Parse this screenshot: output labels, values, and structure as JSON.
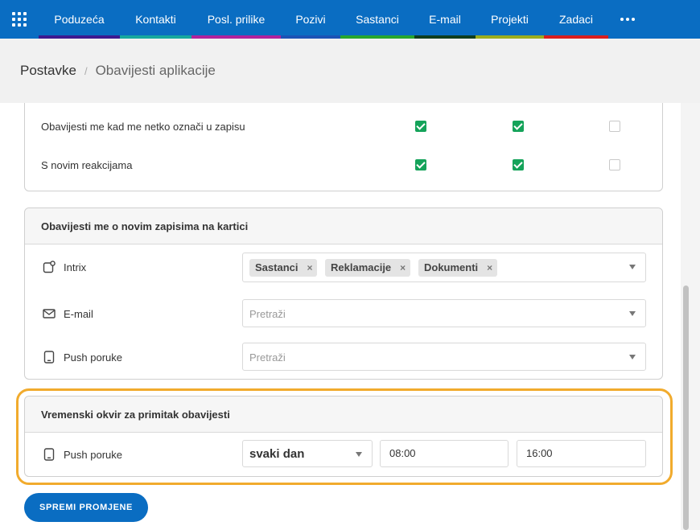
{
  "nav": {
    "items": [
      {
        "label": "Poduzeća",
        "color": "#3d1a8f"
      },
      {
        "label": "Kontakti",
        "color": "#16a89e"
      },
      {
        "label": "Posl. prilike",
        "color": "#b0239c"
      },
      {
        "label": "Pozivi",
        "color": "#1c53b5"
      },
      {
        "label": "Sastanci",
        "color": "#27a52e"
      },
      {
        "label": "E-mail",
        "color": "#0f3d1e"
      },
      {
        "label": "Projekti",
        "color": "#9aac1e"
      },
      {
        "label": "Zadaci",
        "color": "#d81e1e"
      }
    ]
  },
  "breadcrumb": {
    "root": "Postavke",
    "separator": "/",
    "current": "Obavijesti aplikacije"
  },
  "notify_rows": [
    {
      "label": "Obavijesti me kad me netko označi u zapisu",
      "checks": [
        true,
        true,
        false
      ]
    },
    {
      "label": "S novim reakcijama",
      "checks": [
        true,
        true,
        false
      ]
    }
  ],
  "records_section": {
    "title": "Obavijesti me o novim zapisima na kartici",
    "channels": [
      {
        "icon": "intrix-icon",
        "label": "Intrix",
        "tags": [
          "Sastanci",
          "Reklamacije",
          "Dokumenti"
        ],
        "tag_remove": "×"
      },
      {
        "icon": "mail-icon",
        "label": "E-mail",
        "placeholder": "Pretraži"
      },
      {
        "icon": "phone-icon",
        "label": "Push poruke",
        "placeholder": "Pretraži"
      }
    ]
  },
  "timeframe_section": {
    "title": "Vremenski okvir za primitak obavijesti",
    "channel_label": "Push poruke",
    "frequency": "svaki dan",
    "from": "08:00",
    "to": "16:00"
  },
  "save_button": "SPREMI PROMJENE",
  "colors": {
    "primary": "#0a6dc2",
    "check": "#15a35a",
    "highlight": "#f1ab2d"
  }
}
